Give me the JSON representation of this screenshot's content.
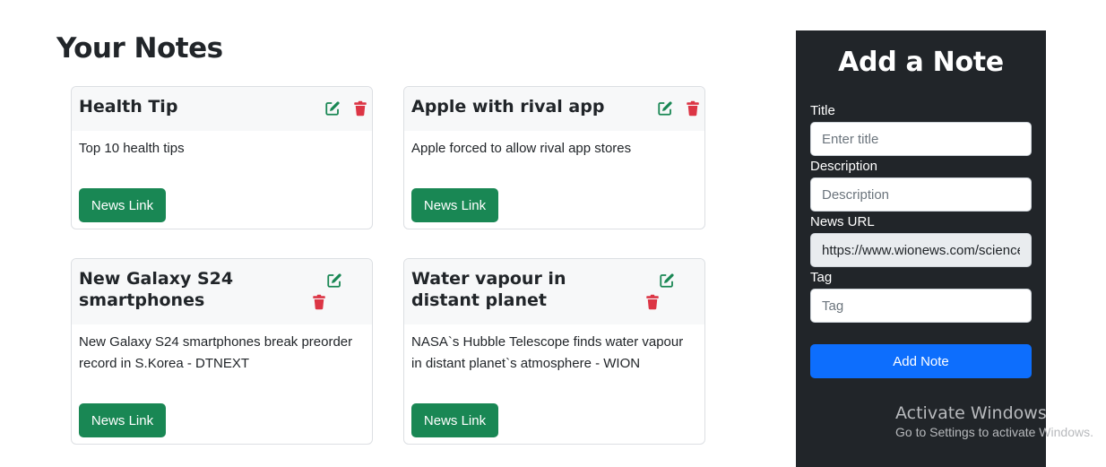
{
  "notes_heading": "Your Notes",
  "notes": [
    {
      "title": "Health Tip",
      "description": "Top 10 health tips",
      "link_label": "News Link"
    },
    {
      "title": "Apple with rival app",
      "description": "Apple forced to allow rival app stores",
      "link_label": "News Link"
    },
    {
      "title": "New Galaxy S24 smartphones",
      "description": "New Galaxy S24 smartphones break preorder record in S.Korea - DTNEXT",
      "link_label": "News Link"
    },
    {
      "title": "Water vapour in distant planet",
      "description": "NASA`s Hubble Telescope finds water vapour in distant planet`s atmosphere - WION",
      "link_label": "News Link"
    }
  ],
  "form": {
    "heading": "Add a Note",
    "title_label": "Title",
    "title_placeholder": "Enter title",
    "description_label": "Description",
    "description_placeholder": "Description",
    "url_label": "News URL",
    "url_value": "https://www.wionews.com/science/nasas-hubble",
    "tag_label": "Tag",
    "tag_placeholder": "Tag",
    "submit_label": "Add Note"
  },
  "watermark": {
    "title": "Activate Windows",
    "subtitle": "Go to Settings to activate Windows."
  },
  "colors": {
    "edit_icon": "#198754",
    "delete_icon": "#dc3545",
    "link_button": "#198754",
    "submit_button": "#0d6efd",
    "sidebar_bg": "#212529"
  },
  "icons": {
    "edit": "edit-icon",
    "delete": "trash-icon"
  }
}
